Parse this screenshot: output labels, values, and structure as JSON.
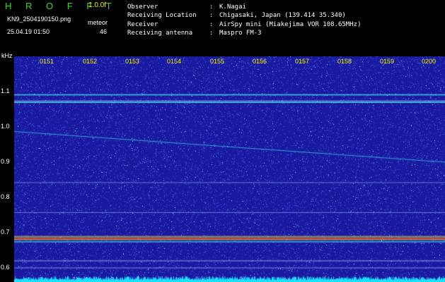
{
  "header": {
    "brand": "H R O F F T",
    "version": "1.0.0f",
    "file_name": "KN9_2504190150.png",
    "meteor_label": "meteor",
    "datetime": "25.04.19 01:50",
    "meteor_count": "46"
  },
  "info_rows": [
    {
      "label": "Observer",
      "value": "K.Nagai"
    },
    {
      "label": "Receiving Location",
      "value": "Chigasaki, Japan (139.414 35.340)"
    },
    {
      "label": "Receiver",
      "value": "AirSpy mini (Miakejima VOR 108.65MHz)"
    },
    {
      "label": "Receiving antenna",
      "value": "Maspro FM-3"
    }
  ],
  "chart_data": {
    "type": "heatmap",
    "y_unit": "kHz",
    "y_ticks": [
      "1.1",
      "1.0",
      "0.9",
      "0.8",
      "0.7",
      "0.6"
    ],
    "time_ticks": [
      "0151",
      "0152",
      "0153",
      "0154",
      "0155",
      "0156",
      "0157",
      "0158",
      "0159",
      "0200"
    ],
    "ylim": [
      0.57,
      1.18
    ],
    "colors": {
      "background": "#1a1aa0",
      "noise": "#3c50dc",
      "line_cyan": "#40e0e8",
      "line_hot": "#e04020",
      "line_yellow": "#e8e040",
      "floor": "#19e0ff"
    }
  }
}
